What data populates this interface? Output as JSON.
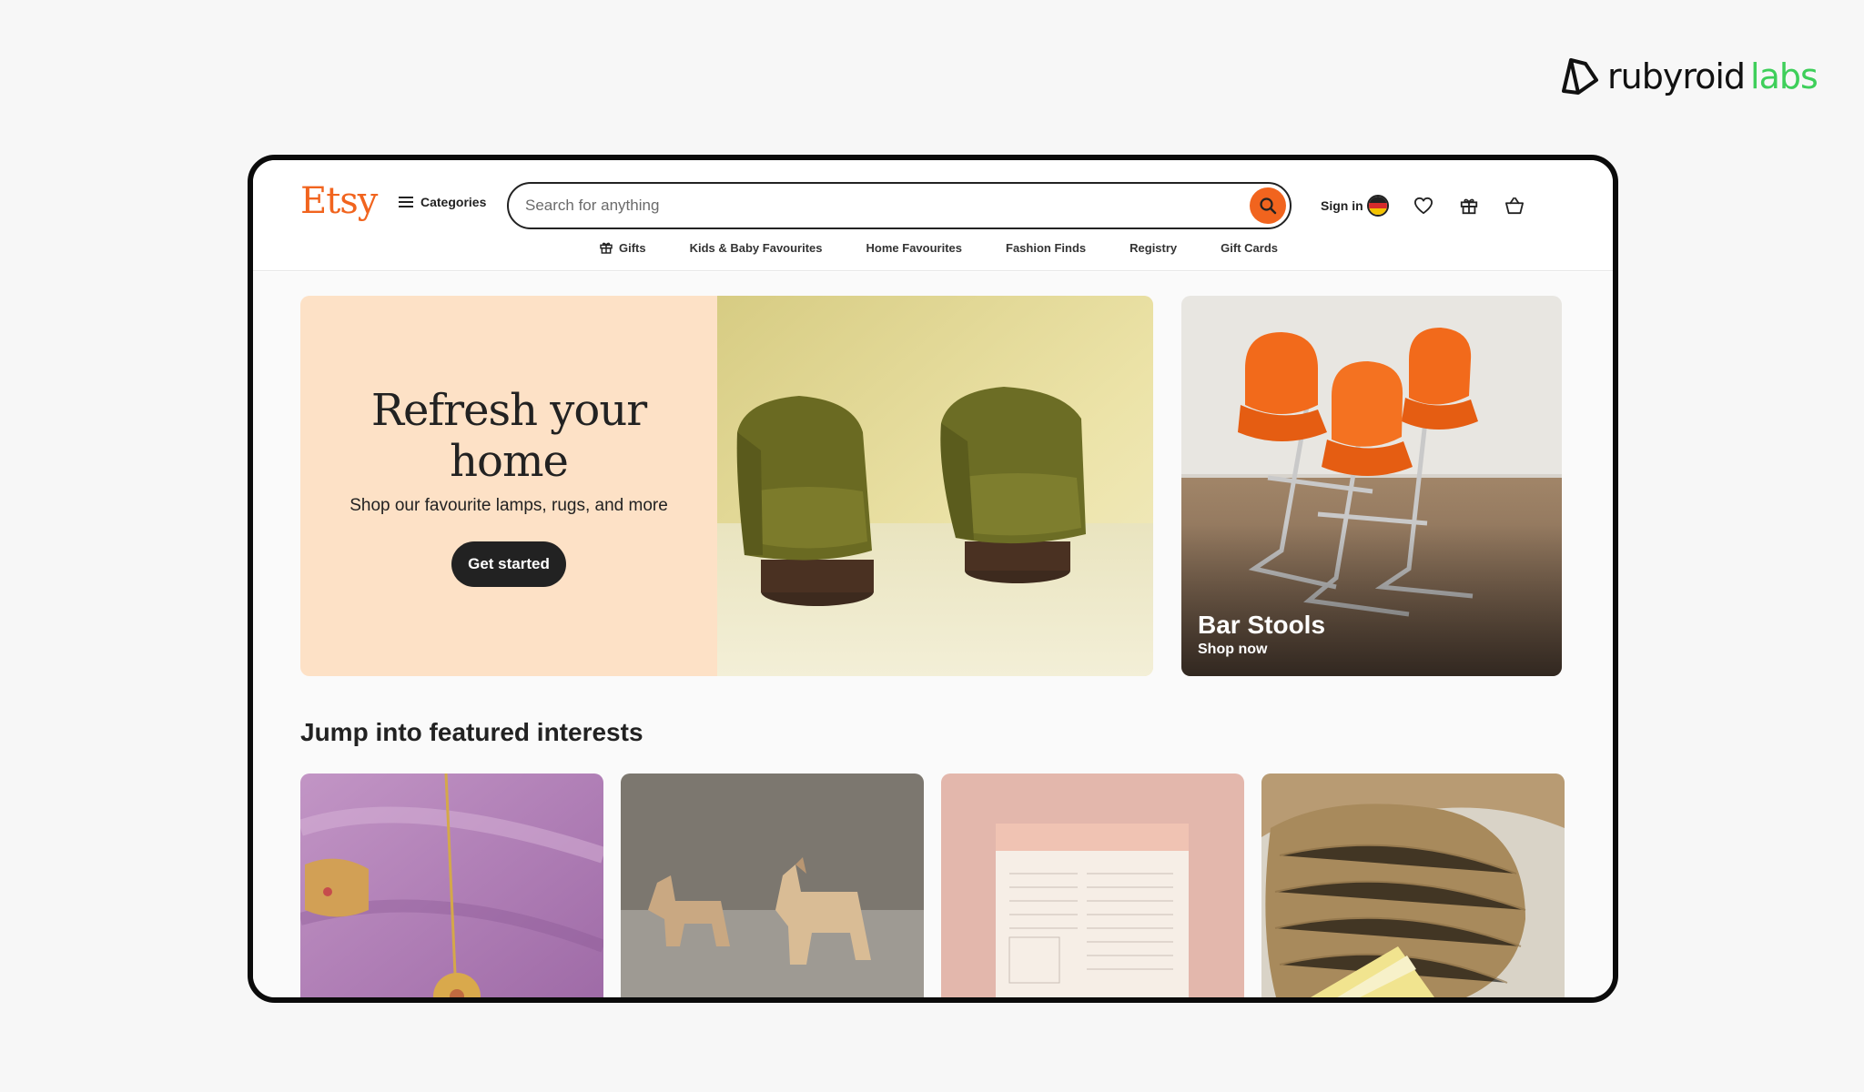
{
  "watermark": {
    "part1": "rubyroid",
    "part2": "labs"
  },
  "header": {
    "logo": "Etsy",
    "categories_label": "Categories",
    "search_placeholder": "Search for anything",
    "signin_label": "Sign in",
    "icons": [
      "flag-de-icon",
      "heart-icon",
      "gift-icon",
      "basket-icon"
    ]
  },
  "nav": {
    "items": [
      {
        "label": "Gifts",
        "icon": "gift-icon"
      },
      {
        "label": "Kids & Baby Favourites"
      },
      {
        "label": "Home Favourites"
      },
      {
        "label": "Fashion Finds"
      },
      {
        "label": "Registry"
      },
      {
        "label": "Gift Cards"
      }
    ]
  },
  "hero": {
    "title": "Refresh your home",
    "subtitle": "Shop our favourite lamps, rugs, and more",
    "button": "Get started"
  },
  "promo": {
    "title": "Bar Stools",
    "link": "Shop now"
  },
  "featured": {
    "title": "Jump into featured interests",
    "tiles": [
      "jewelry",
      "wooden-horses",
      "planner",
      "woven-bag"
    ]
  },
  "colors": {
    "accent": "#f1641e",
    "hero_bg": "#fde1c6",
    "dark": "#222222"
  }
}
